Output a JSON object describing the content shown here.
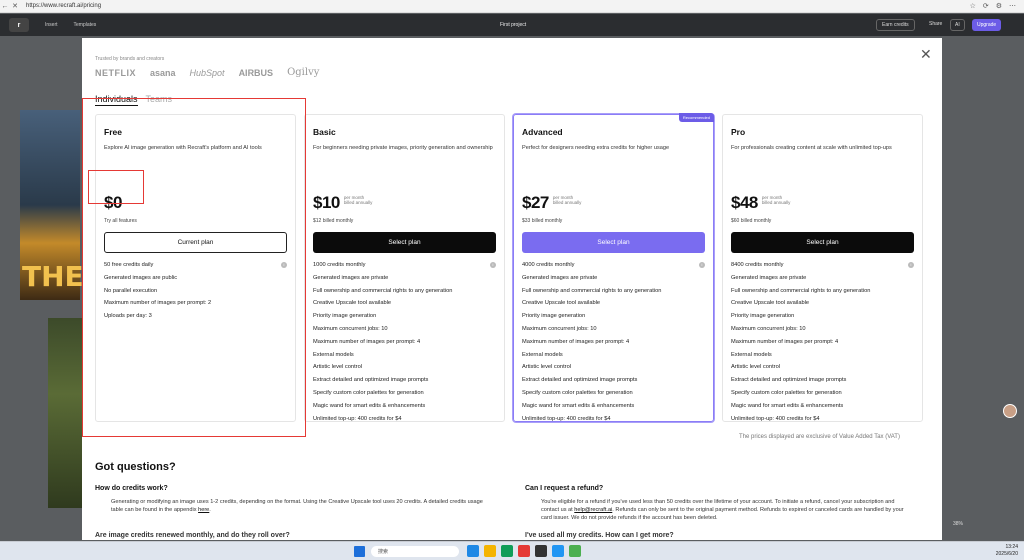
{
  "browser": {
    "url": "https://www.recraft.ai/pricing",
    "back": "←",
    "close": "✕"
  },
  "toolbar": {
    "menu1": "Insert",
    "menu2": "Templates",
    "project": "First project",
    "earn_credits": "Earn credits",
    "share": "Share",
    "ai": "AI",
    "upgrade": "Upgrade"
  },
  "background_art_text": "THE",
  "modal": {
    "trusted_label": "Trusted by brands and creators",
    "brands": [
      "NETFLIX",
      "asana",
      "HubSpot",
      "AIRBUS",
      "Ogilvy"
    ],
    "tabs": [
      "Individuals",
      "Teams"
    ],
    "recommended_badge": "Recommended",
    "plans": [
      {
        "name": "Free",
        "description": "Explore AI image generation with Recraft's platform and AI tools",
        "price": "$0",
        "per_month": "",
        "billed_annually": "",
        "billed_note": "Try all features",
        "button": "Current plan",
        "features": [
          "50 free credits daily",
          "Generated images are public",
          "No parallel execution",
          "Maximum number of images per prompt: 2",
          "Uploads per day: 3"
        ]
      },
      {
        "name": "Basic",
        "description": "For beginners needing private images, priority generation and ownership",
        "price": "$10",
        "per_month": "per month",
        "billed_annually": "billed annually",
        "billed_note": "$12 billed monthly",
        "button": "Select plan",
        "features": [
          "1000 credits monthly",
          "Generated images are private",
          "Full ownership and commercial rights to any generation",
          "Creative Upscale tool available",
          "Priority image generation",
          "Maximum concurrent jobs: 10",
          "Maximum number of images per prompt: 4",
          "External models",
          "Artistic level control",
          "Extract detailed and optimized image prompts",
          "Specify custom color palettes for generation",
          "Magic wand for smart edits & enhancements",
          "Unlimited top-up: 400 credits for $4"
        ]
      },
      {
        "name": "Advanced",
        "description": "Perfect for designers needing extra credits for higher usage",
        "price": "$27",
        "per_month": "per month",
        "billed_annually": "billed annually",
        "billed_note": "$33 billed monthly",
        "button": "Select plan",
        "features": [
          "4000 credits monthly",
          "Generated images are private",
          "Full ownership and commercial rights to any generation",
          "Creative Upscale tool available",
          "Priority image generation",
          "Maximum concurrent jobs: 10",
          "Maximum number of images per prompt: 4",
          "External models",
          "Artistic level control",
          "Extract detailed and optimized image prompts",
          "Specify custom color palettes for generation",
          "Magic wand for smart edits & enhancements",
          "Unlimited top-up: 400 credits for $4"
        ]
      },
      {
        "name": "Pro",
        "description": "For professionals creating content at scale with unlimited top-ups",
        "price": "$48",
        "per_month": "per month",
        "billed_annually": "billed annually",
        "billed_note": "$60 billed monthly",
        "button": "Select plan",
        "features": [
          "8400 credits monthly",
          "Generated images are private",
          "Full ownership and commercial rights to any generation",
          "Creative Upscale tool available",
          "Priority image generation",
          "Maximum concurrent jobs: 10",
          "Maximum number of images per prompt: 4",
          "External models",
          "Artistic level control",
          "Extract detailed and optimized image prompts",
          "Specify custom color palettes for generation",
          "Magic wand for smart edits & enhancements",
          "Unlimited top-up: 400 credits for $4"
        ]
      }
    ],
    "vat_note": "The prices displayed are exclusive of Value Added Tax (VAT)",
    "faq_title": "Got questions?",
    "faq": [
      {
        "q": "How do credits work?",
        "a1": "Generating or modifying an image uses 1-2 credits, depending on the format. Using the Creative Upscale tool uses 20 credits. A detailed credits usage table can be found in the appendix",
        "link": "here",
        "a2": "."
      },
      {
        "q": "Can I request a refund?",
        "a1": "You're eligible for a refund if you've used less than 50 credits over the lifetime of your account. To initiate a refund, cancel your subscription and contact us at",
        "link": "help@recraft.ai",
        "a2": ". Refunds can only be sent to the original payment method. Refunds to expired or canceled cards are handled by your card issuer. We do not provide refunds if the account has been deleted."
      },
      {
        "q": "Are image credits renewed monthly, and do they roll over?"
      },
      {
        "q": "I've used all my credits. How can I get more?"
      }
    ]
  },
  "zoom": "38%",
  "taskbar": {
    "search_placeholder": "搜索",
    "time": "13:24",
    "date": "2025/6/20"
  },
  "colors": {
    "accent": "#6c5ce7",
    "annotation": "#e53935"
  }
}
